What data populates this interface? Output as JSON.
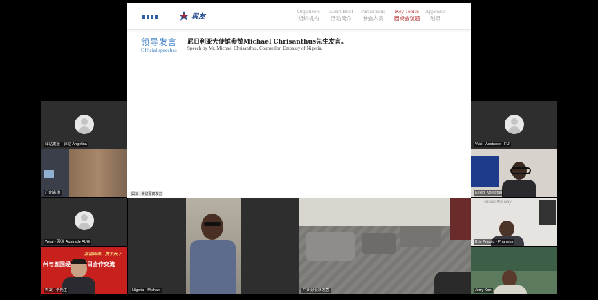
{
  "slide": {
    "logo_text": "舆友",
    "nav": [
      {
        "en": "Organizers",
        "cn": "组织机构",
        "active": false
      },
      {
        "en": "Event Brief",
        "cn": "活动简介",
        "active": false
      },
      {
        "en": "Participants",
        "cn": "参会人员",
        "active": false
      },
      {
        "en": "Key Topics",
        "cn": "圆桌会议题",
        "active": true
      },
      {
        "en": "Appendix",
        "cn": "附录",
        "active": false
      }
    ],
    "section_cn": "领导发言",
    "section_en": "Official speeches",
    "speech_title": "尼日利亚大使馆参赞Michael Chrisanthus先生发言。",
    "speech_subtitle": "Speech by Mr. Michael Chrisanthus, Counsellor, Embassy of Nigeria.",
    "presenter_label": "舆友 - 演讲嘉宾发言"
  },
  "participants": {
    "left_top": "驿站掘金 - 驿站 Angelina",
    "left_room": "广州会场",
    "left_avatar2": "Weal - 澳洲 Austrade AUG",
    "left_banner": "舆友 - 李先生",
    "banner_line1": "友谊四海，携手天下",
    "banner_line2": "州与五国经贸省项目合作交流",
    "center_michael": "Nigeria - Michael",
    "center_room": "广州分会场发言",
    "right_top": "Vuki - Austrade - FIJ",
    "right_kelepi": "Kelepi Korodtau",
    "right_kris": "Kris Prasad - Pharmus",
    "right_jerry": "Jerry Kan",
    "right_wall_text": "shows the way"
  },
  "colors": {
    "accent_blue": "#3d7fc1",
    "active_red": "#b22a2a",
    "banner_red": "#c8201d"
  }
}
